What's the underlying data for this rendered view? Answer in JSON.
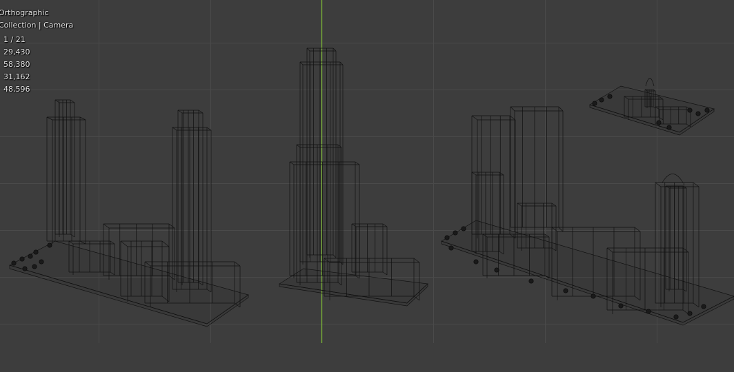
{
  "viewport": {
    "view_name": "Orthographic",
    "collection_label": "Collection | Camera",
    "stats": [
      "1 / 21",
      "29,430",
      "58,380",
      "31,162",
      "48,596"
    ],
    "colors": {
      "background": "#3d3d3d",
      "grid": "#4a4a4a",
      "y_axis": "#7fb838",
      "wire": "#0a0a0a"
    }
  }
}
